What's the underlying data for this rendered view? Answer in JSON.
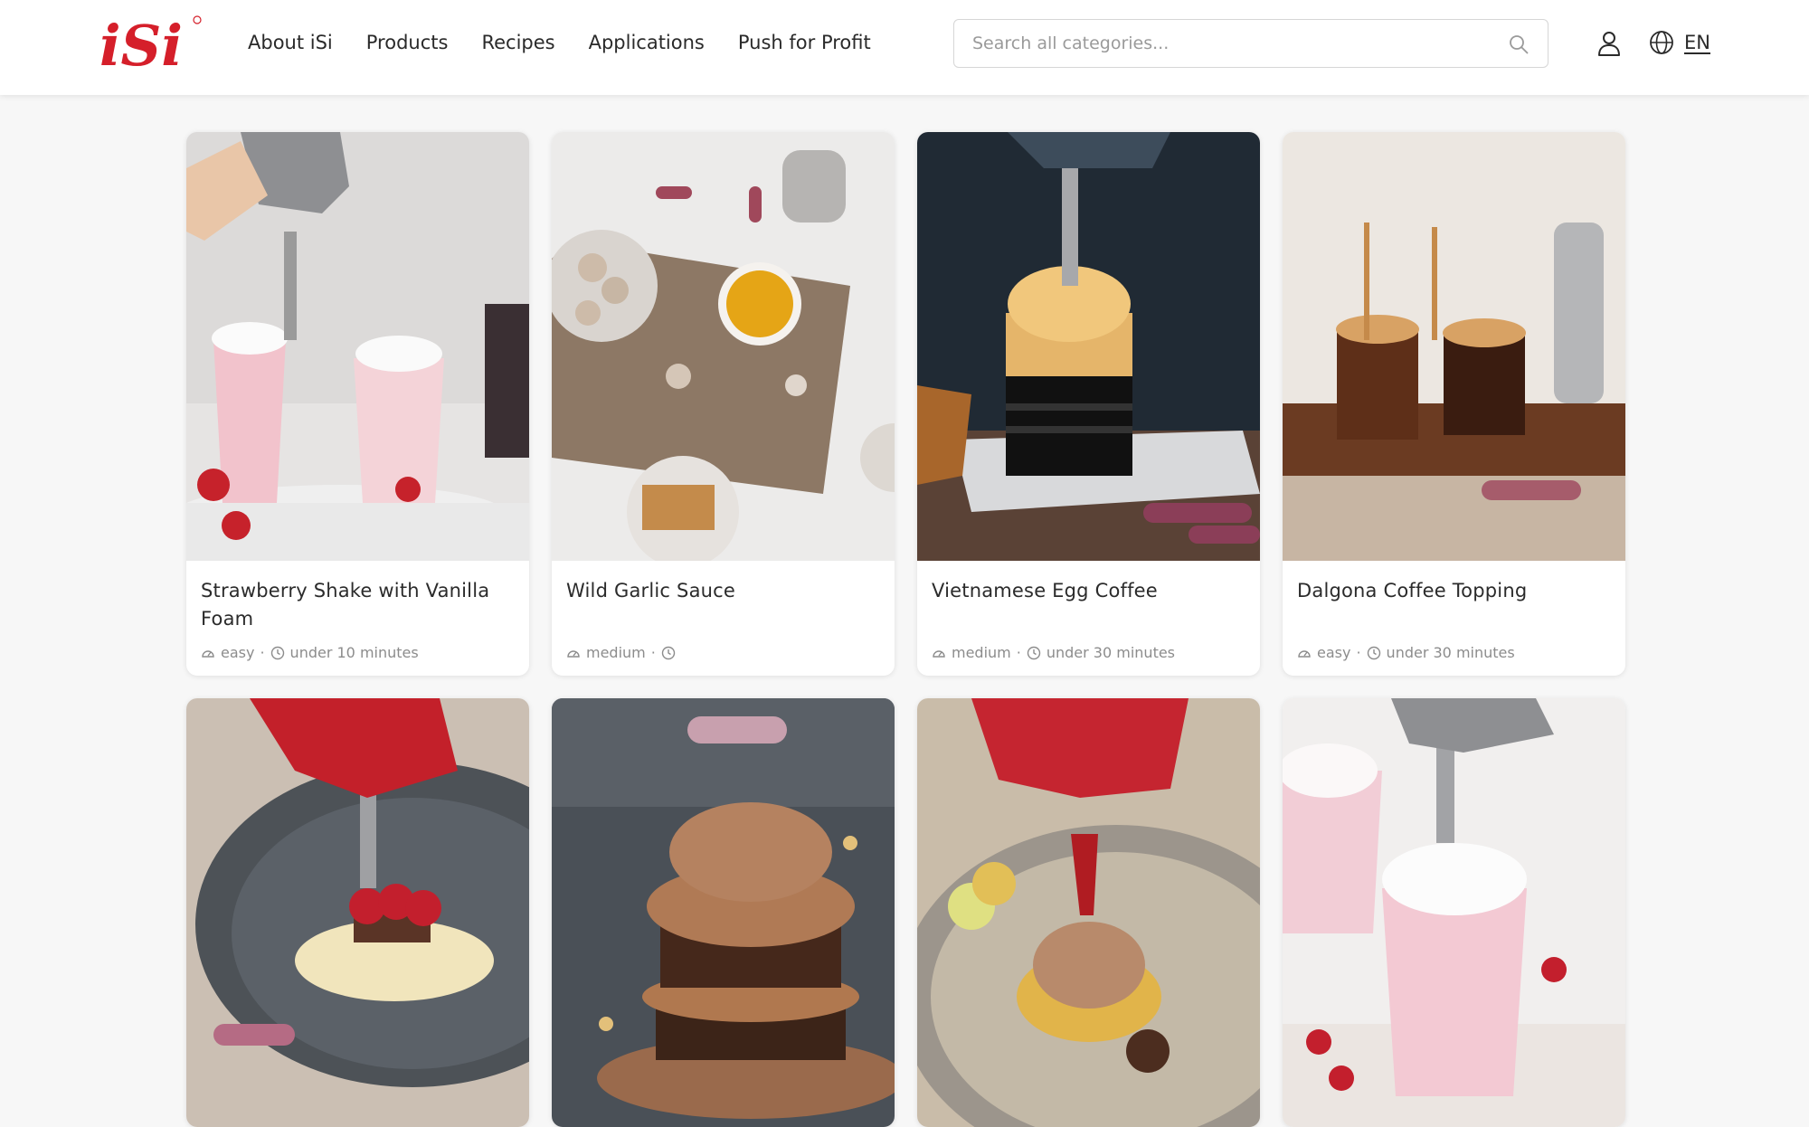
{
  "brand": {
    "logo_text": "iSi",
    "accent": "#d51f2a"
  },
  "nav": {
    "items": [
      {
        "label": "About iSi"
      },
      {
        "label": "Products"
      },
      {
        "label": "Recipes"
      },
      {
        "label": "Applications"
      },
      {
        "label": "Push for Profit"
      }
    ]
  },
  "search": {
    "placeholder": "Search all categories...",
    "value": "",
    "icon": "search-icon"
  },
  "header_actions": {
    "user_icon": "user-icon",
    "globe_icon": "globe-icon",
    "language": "EN"
  },
  "recipes": [
    {
      "title": "Strawberry Shake with Vanilla Foam",
      "difficulty": "easy",
      "time": "under 10 minutes"
    },
    {
      "title": "Wild Garlic Sauce",
      "difficulty": "medium",
      "time": ""
    },
    {
      "title": "Vietnamese Egg Coffee",
      "difficulty": "medium",
      "time": "under 30 minutes"
    },
    {
      "title": "Dalgona Coffee Topping",
      "difficulty": "easy",
      "time": "under 30 minutes"
    }
  ],
  "meta_icons": {
    "difficulty": "gauge-icon",
    "time": "clock-icon"
  }
}
